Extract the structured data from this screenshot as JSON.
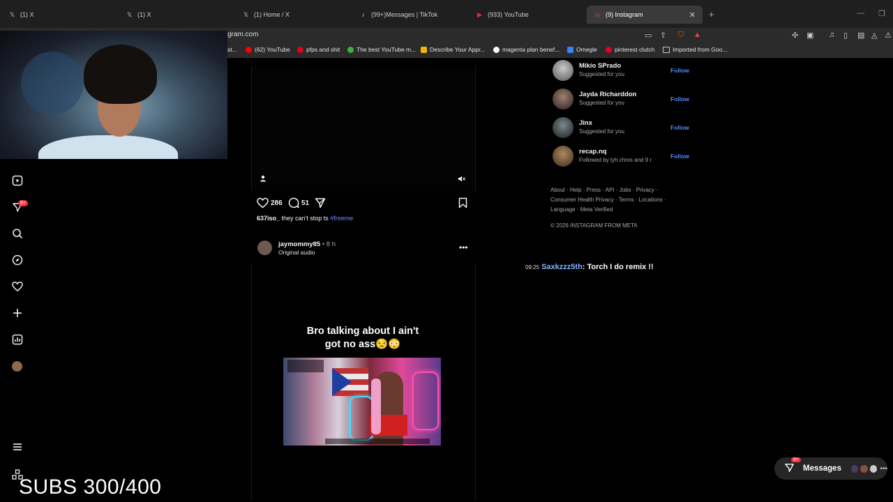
{
  "browser": {
    "tabs": [
      {
        "label": "(1) X",
        "icon": "x-logo-icon",
        "active": false
      },
      {
        "label": "(1) X",
        "icon": "x-logo-icon",
        "active": false
      },
      {
        "label": "(1) Home / X",
        "icon": "x-logo-icon",
        "active": false
      },
      {
        "label": "(99+)Messages | TikTok",
        "icon": "tiktok-icon",
        "active": false
      },
      {
        "label": "(933) YouTube",
        "icon": "youtube-icon",
        "active": false
      },
      {
        "label": "(9) Instagram",
        "icon": "instagram-icon",
        "active": true
      }
    ],
    "url": "gram.com",
    "bookmarks": [
      {
        "label": "st...",
        "icon": "bookmark-icon"
      },
      {
        "label": "(62) YouTube",
        "icon": "youtube-icon",
        "color": "#ff0000"
      },
      {
        "label": "pfps and shit",
        "icon": "pinterest-icon",
        "color": "#e60023"
      },
      {
        "label": "The best YouTube m...",
        "icon": "leaf-icon",
        "color": "#3bb34a"
      },
      {
        "label": "Describe Your Appr...",
        "icon": "m-icon",
        "color": "#f6b500"
      },
      {
        "label": "magenta plan benef...",
        "icon": "google-icon",
        "color": "#ffffff"
      },
      {
        "label": "Omegle",
        "icon": "omegle-icon",
        "color": "#3b82f6"
      },
      {
        "label": "pinterest clutch",
        "icon": "pinterest-icon",
        "color": "#e60023"
      },
      {
        "label": "Imported from Goo...",
        "icon": "folder-icon",
        "color": "#cccccc"
      }
    ]
  },
  "sidebar": {
    "icons": [
      "reels-icon",
      "messages-icon",
      "search-icon",
      "explore-icon",
      "heart-icon",
      "create-icon",
      "dashboard-icon",
      "profile-avatar",
      "menu-icon",
      "more-icon"
    ],
    "messages_badge": "9+"
  },
  "overlay": {
    "subs": "SUBS 300/400"
  },
  "post1": {
    "likes": "286",
    "comments": "51",
    "caption_user": "637iso_",
    "caption_text": " they can't stop ts ",
    "caption_tag": "#freeme"
  },
  "post2": {
    "user": "jaymommy85",
    "time": " • 8 h",
    "audio": "Original audio",
    "text_line1": "Bro talking about I ain't",
    "text_line2": "got no ass😒😳"
  },
  "suggestions": [
    {
      "name": "Mikio SPrado",
      "sub": "Suggested for you",
      "follow": "Follow"
    },
    {
      "name": "Jayda Richarddon",
      "sub": "Suggested for you",
      "follow": "Follow"
    },
    {
      "name": "Jinx",
      "sub": "Suggested for you",
      "follow": "Follow"
    },
    {
      "name": "recap.nq",
      "sub": "Followed by tyh.chrxs and 9 r",
      "follow": "Follow"
    }
  ],
  "footer": {
    "links": "About · Help · Press · API · Jobs · Privacy · Consumer Health Privacy · Terms · Locations · Language · Meta Verified",
    "copyright": "© 2026 INSTAGRAM FROM META"
  },
  "chat": {
    "time": "09:25",
    "name": "Saxkzzz5th",
    "message": ": Torch I do remix !!"
  },
  "messages_button": {
    "label": "Messages",
    "badge": "9+"
  }
}
